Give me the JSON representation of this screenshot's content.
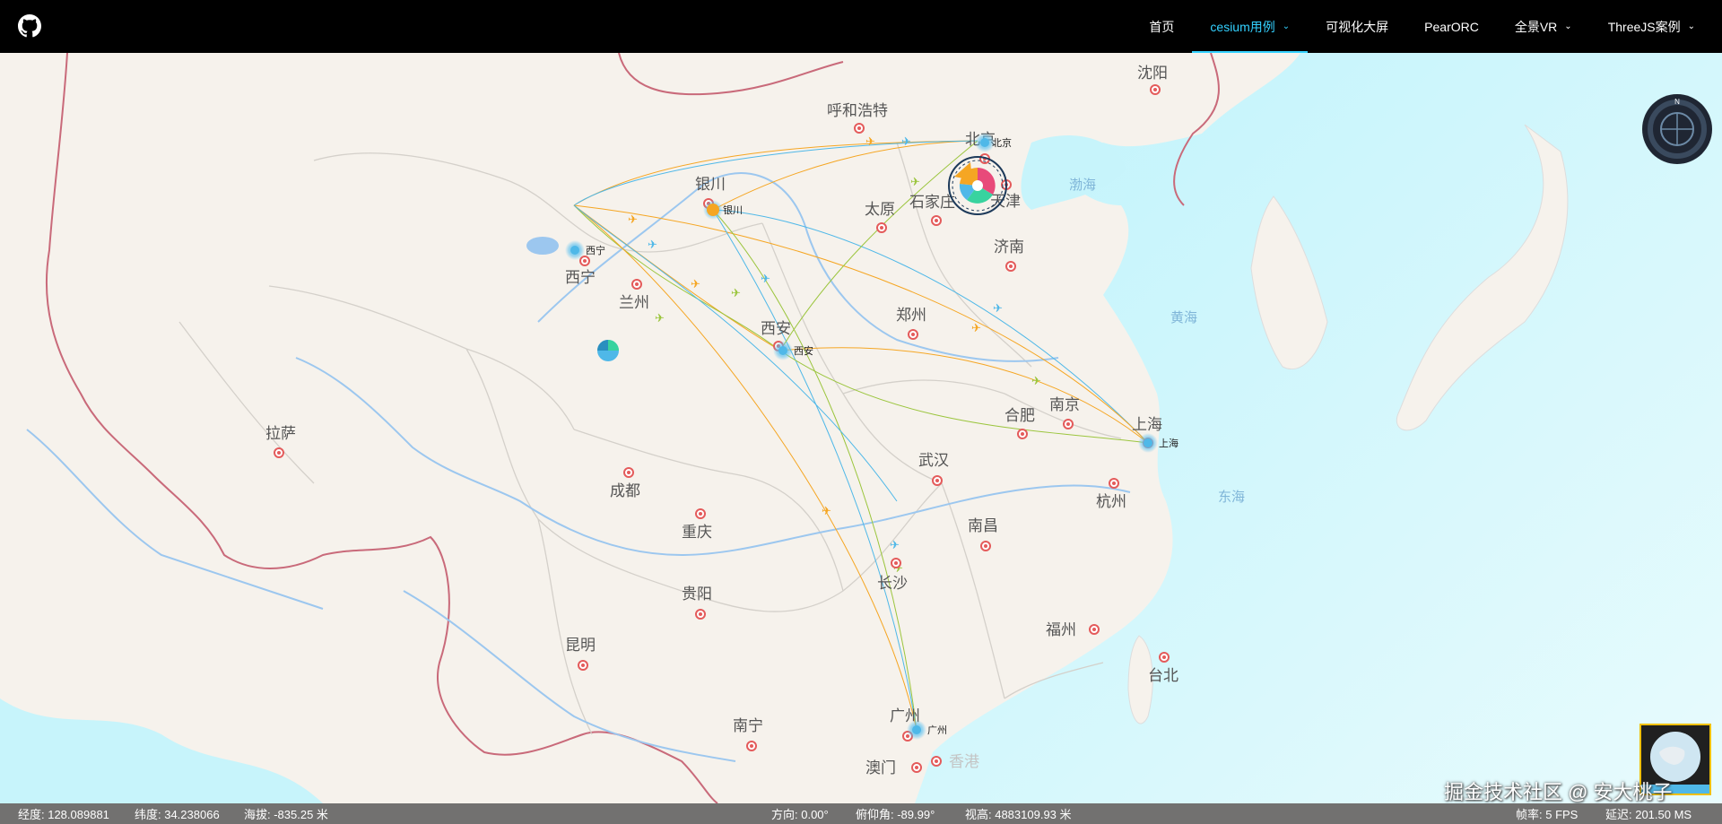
{
  "nav": {
    "github_icon": "github-icon",
    "items": [
      {
        "label": "首页",
        "active": false,
        "dropdown": false
      },
      {
        "label": "cesium用例",
        "active": true,
        "dropdown": true
      },
      {
        "label": "可视化大屏",
        "active": false,
        "dropdown": false
      },
      {
        "label": "PearORC",
        "active": false,
        "dropdown": false
      },
      {
        "label": "全景VR",
        "active": false,
        "dropdown": true
      },
      {
        "label": "ThreeJS案例",
        "active": false,
        "dropdown": true
      }
    ]
  },
  "map": {
    "cities": [
      {
        "name": "沈阳"
      },
      {
        "name": "呼和浩特"
      },
      {
        "name": "北京"
      },
      {
        "name": "银川"
      },
      {
        "name": "太原"
      },
      {
        "name": "石家庄"
      },
      {
        "name": "天津"
      },
      {
        "name": "西宁"
      },
      {
        "name": "兰州"
      },
      {
        "name": "济南"
      },
      {
        "name": "郑州"
      },
      {
        "name": "西安"
      },
      {
        "name": "合肥"
      },
      {
        "name": "南京"
      },
      {
        "name": "上海"
      },
      {
        "name": "拉萨"
      },
      {
        "name": "武汉"
      },
      {
        "name": "成都"
      },
      {
        "name": "杭州"
      },
      {
        "name": "重庆"
      },
      {
        "name": "南昌"
      },
      {
        "name": "长沙"
      },
      {
        "name": "贵阳"
      },
      {
        "name": "福州"
      },
      {
        "name": "昆明"
      },
      {
        "name": "台北"
      },
      {
        "name": "广州"
      },
      {
        "name": "南宁"
      },
      {
        "name": "澳门"
      },
      {
        "name": "香港"
      }
    ],
    "seas": [
      "渤海",
      "黄海",
      "东海"
    ],
    "hub_labels": [
      "北京",
      "银川",
      "西宁",
      "西安",
      "上海",
      "广州"
    ]
  },
  "status": {
    "longitude": "经度: 128.089881",
    "latitude": "纬度: 34.238066",
    "altitude": "海拔: -835.25 米",
    "heading": "方向: 0.00°",
    "pitch": "俯仰角: -89.99°",
    "view_height": "视高: 4883109.93 米",
    "fps": "帧率: 5 FPS",
    "latency": "延迟: 201.50 MS"
  },
  "watermark": "掘金技术社区 @ 安大桃子",
  "compass_label": "N",
  "colors": {
    "accent": "#33d1ff",
    "route_orange": "#f5a623",
    "route_blue": "#4fb8e8",
    "route_green": "#9bc53d"
  }
}
